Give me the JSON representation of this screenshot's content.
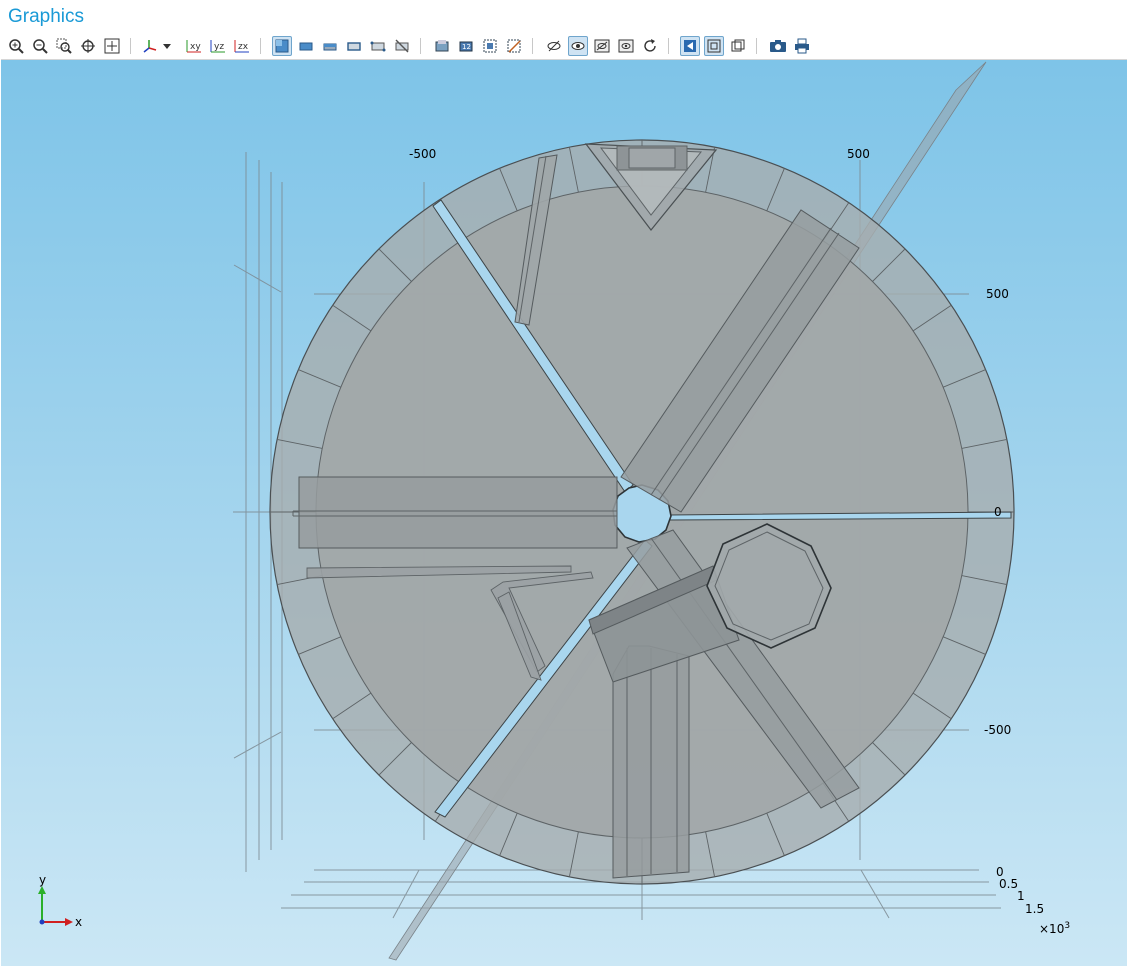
{
  "panel": {
    "title": "Graphics"
  },
  "toolbar": {
    "buttons": [
      {
        "name": "zoom-in-icon"
      },
      {
        "name": "zoom-out-icon"
      },
      {
        "name": "zoom-box-icon"
      },
      {
        "name": "zoom-selected-icon"
      },
      {
        "name": "zoom-extents-icon"
      },
      {
        "name": "view-axis-icon"
      },
      {
        "name": "xy-view-icon",
        "label": "xy"
      },
      {
        "name": "yz-view-icon",
        "label": "yz"
      },
      {
        "name": "zx-view-icon",
        "label": "zx"
      },
      {
        "name": "select-objects-icon"
      },
      {
        "name": "select-domains-icon"
      },
      {
        "name": "select-boundaries-icon"
      },
      {
        "name": "select-edges-icon"
      },
      {
        "name": "select-points-icon"
      },
      {
        "name": "clear-selection-icon"
      },
      {
        "name": "build-selection-icon"
      },
      {
        "name": "create-selection-icon"
      },
      {
        "name": "box-selection-icon"
      },
      {
        "name": "hide-selection-icon"
      },
      {
        "name": "hide-icon"
      },
      {
        "name": "show-icon"
      },
      {
        "name": "hide-all-icon"
      },
      {
        "name": "reset-hiding-icon"
      },
      {
        "name": "refresh-icon"
      },
      {
        "name": "transparency-icon"
      },
      {
        "name": "wireframe-icon"
      },
      {
        "name": "scene-light-icon"
      },
      {
        "name": "camera-icon"
      },
      {
        "name": "print-icon"
      }
    ]
  },
  "axes": {
    "x_ticks": [
      "-500",
      "500"
    ],
    "y_ticks": [
      "500",
      "0",
      "-500"
    ],
    "z_ticks": [
      "0",
      "0.5",
      "1",
      "1.5"
    ],
    "z_multiplier": "×10",
    "z_exponent": "3"
  },
  "triad": {
    "x_label": "x",
    "y_label": "y"
  },
  "colors": {
    "accent": "#1a9ad6",
    "geometry_fill": "#a6acae",
    "geometry_edge": "#4a4f52",
    "background_top": "#7ec4e8",
    "background_bottom": "#cbe7f5"
  }
}
